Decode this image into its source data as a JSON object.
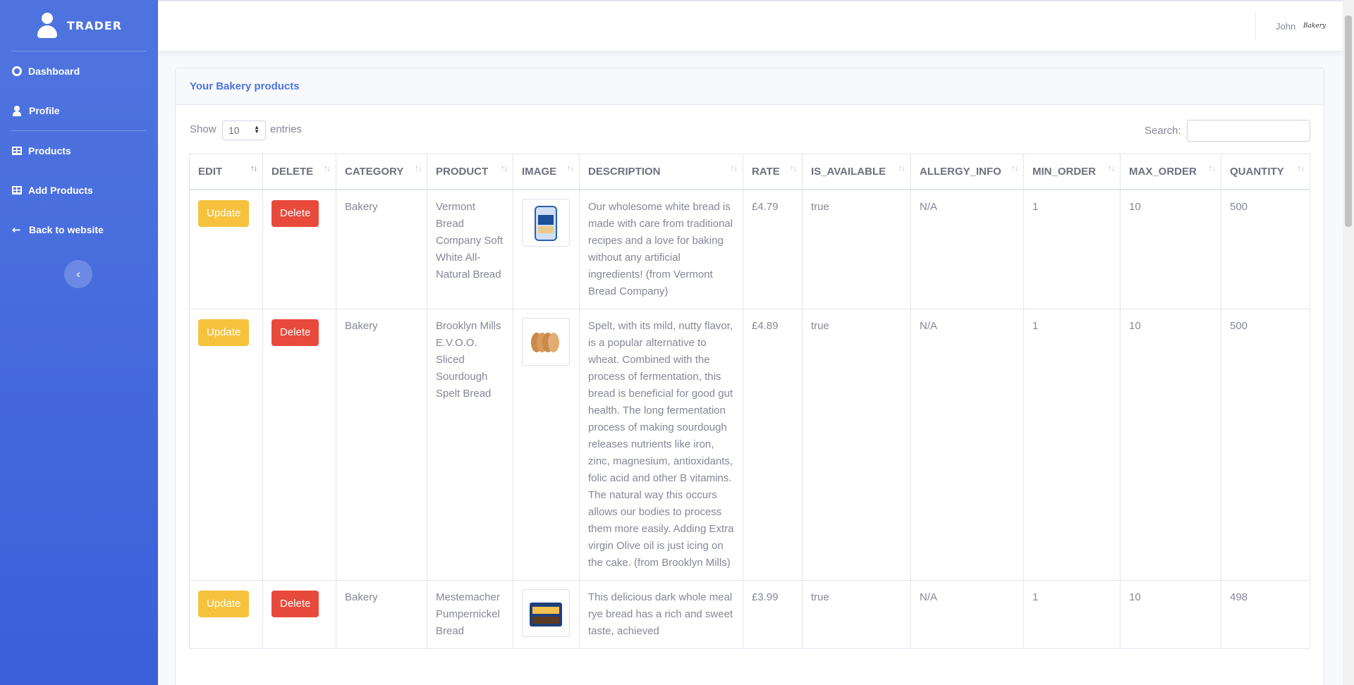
{
  "sidebar": {
    "brand": "TRADER",
    "items": [
      {
        "label": "Dashboard",
        "icon": "tachometer-icon"
      },
      {
        "label": "Profile",
        "icon": "user-icon"
      },
      {
        "label": "Products",
        "icon": "table-icon"
      },
      {
        "label": "Add Products",
        "icon": "table-icon"
      },
      {
        "label": "Back to website",
        "icon": "arrow-left-icon"
      }
    ],
    "toggle": "‹"
  },
  "topbar": {
    "user_name": "John",
    "shop_logo": "Bakery"
  },
  "card": {
    "title": "Your Bakery products"
  },
  "controls": {
    "show_label": "Show",
    "entries_value": "10",
    "entries_label": "entries",
    "search_label": "Search:",
    "search_value": ""
  },
  "table": {
    "columns": [
      "EDIT",
      "DELETE",
      "CATEGORY",
      "PRODUCT",
      "IMAGE",
      "DESCRIPTION",
      "RATE",
      "IS_AVAILABLE",
      "ALLERGY_INFO",
      "MIN_ORDER",
      "MAX_ORDER",
      "QUANTITY"
    ],
    "update_label": "Update",
    "delete_label": "Delete",
    "rows": [
      {
        "category": "Bakery",
        "product": "Vermont Bread Company Soft White All-Natural Bread",
        "description": "Our wholesome white bread is made with care from traditional recipes and a love for baking without any artificial ingredients! (from Vermont Bread Company)",
        "rate": "£4.79",
        "is_available": "true",
        "allergy_info": "N/A",
        "min_order": "1",
        "max_order": "10",
        "quantity": "500"
      },
      {
        "category": "Bakery",
        "product": "Brooklyn Mills E.V.O.O. Sliced Sourdough Spelt Bread",
        "description": "Spelt, with its mild, nutty flavor, is a popular alternative to wheat. Combined with the process of fermentation, this bread is beneficial for good gut health. The long fermentation process of making sourdough releases nutrients like iron, zinc, magnesium, antioxidants, folic acid and other B vitamins. The natural way this occurs allows our bodies to process them more easily. Adding Extra virgin Olive oil is just icing on the cake. (from Brooklyn Mills)",
        "rate": "£4.89",
        "is_available": "true",
        "allergy_info": "N/A",
        "min_order": "1",
        "max_order": "10",
        "quantity": "500"
      },
      {
        "category": "Bakery",
        "product": "Mestemacher Pumpernickel Bread",
        "description": "This delicious dark whole meal rye bread has a rich and sweet taste, achieved",
        "rate": "£3.99",
        "is_available": "true",
        "allergy_info": "N/A",
        "min_order": "1",
        "max_order": "10",
        "quantity": "498"
      }
    ]
  },
  "colors": {
    "primary": "#4e73df",
    "warning": "#f6c23e",
    "danger": "#e74a3b"
  }
}
